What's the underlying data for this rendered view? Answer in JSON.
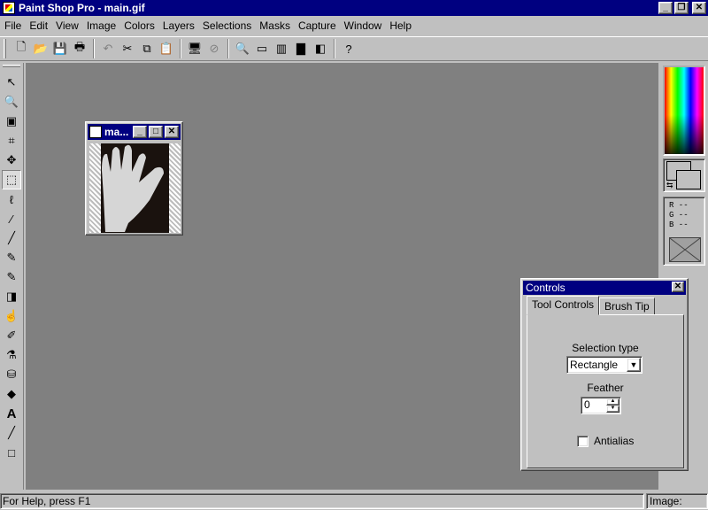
{
  "app": {
    "title": "Paint Shop Pro - main.gif"
  },
  "menu": [
    {
      "label": "File",
      "name": "menu-file"
    },
    {
      "label": "Edit",
      "name": "menu-edit"
    },
    {
      "label": "View",
      "name": "menu-view"
    },
    {
      "label": "Image",
      "name": "menu-image"
    },
    {
      "label": "Colors",
      "name": "menu-colors"
    },
    {
      "label": "Layers",
      "name": "menu-layers"
    },
    {
      "label": "Selections",
      "name": "menu-selections"
    },
    {
      "label": "Masks",
      "name": "menu-masks"
    },
    {
      "label": "Capture",
      "name": "menu-capture"
    },
    {
      "label": "Window",
      "name": "menu-window"
    },
    {
      "label": "Help",
      "name": "menu-help"
    }
  ],
  "toolbar": [
    {
      "icon": "new-file-icon",
      "glyph": "🗋"
    },
    {
      "icon": "open-folder-icon",
      "glyph": "📂"
    },
    {
      "icon": "save-icon",
      "glyph": "💾"
    },
    {
      "icon": "print-icon",
      "glyph": "🖶"
    },
    {
      "sep": true
    },
    {
      "icon": "undo-icon",
      "glyph": "↶",
      "disabled": true
    },
    {
      "icon": "cut-icon",
      "glyph": "✂"
    },
    {
      "icon": "copy-icon",
      "glyph": "⧉"
    },
    {
      "icon": "paste-icon",
      "glyph": "📋"
    },
    {
      "sep": true
    },
    {
      "icon": "full-screen-icon",
      "glyph": "🖥"
    },
    {
      "icon": "no-entry-icon",
      "glyph": "⊘",
      "disabled": true
    },
    {
      "sep": true
    },
    {
      "icon": "zoom-icon",
      "glyph": "🔍"
    },
    {
      "icon": "toolbar-toggle-icon",
      "glyph": "▭"
    },
    {
      "icon": "color-palette-icon",
      "glyph": "▥"
    },
    {
      "icon": "histogram-icon",
      "glyph": "▇"
    },
    {
      "icon": "layers-icon",
      "glyph": "◧"
    },
    {
      "sep": true
    },
    {
      "icon": "context-help-icon",
      "glyph": "?"
    }
  ],
  "tools": [
    {
      "icon": "arrow-tool-icon",
      "glyph": "↖"
    },
    {
      "icon": "zoom-tool-icon",
      "glyph": "🔍"
    },
    {
      "icon": "deform-tool-icon",
      "glyph": "▣"
    },
    {
      "icon": "crop-tool-icon",
      "glyph": "⌗"
    },
    {
      "icon": "mover-tool-icon",
      "glyph": "✥"
    },
    {
      "icon": "selection-tool-icon",
      "glyph": "⬚",
      "active": true
    },
    {
      "icon": "freehand-tool-icon",
      "glyph": "ℓ"
    },
    {
      "icon": "magic-wand-icon",
      "glyph": "⁄"
    },
    {
      "icon": "dropper-icon",
      "glyph": "╱"
    },
    {
      "icon": "paintbrush-icon",
      "glyph": "✎"
    },
    {
      "icon": "clone-brush-icon",
      "glyph": "✎"
    },
    {
      "icon": "color-replacer-icon",
      "glyph": "◨"
    },
    {
      "icon": "retouch-icon",
      "glyph": "☝"
    },
    {
      "icon": "eraser-icon",
      "glyph": "✐"
    },
    {
      "icon": "picture-tube-icon",
      "glyph": "⚗"
    },
    {
      "icon": "airbrush-icon",
      "glyph": "⛁"
    },
    {
      "icon": "flood-fill-icon",
      "glyph": "◆"
    },
    {
      "icon": "text-tool-icon",
      "glyph": "A"
    },
    {
      "icon": "line-tool-icon",
      "glyph": "╱"
    },
    {
      "icon": "shape-tool-icon",
      "glyph": "□"
    }
  ],
  "image_window": {
    "title": "ma..."
  },
  "color_panel": {
    "r": "R --",
    "g": "G --",
    "b": "B --"
  },
  "controls": {
    "title": "Controls",
    "tabs": [
      "Tool Controls",
      "Brush Tip"
    ],
    "selection_type_label": "Selection type",
    "selection_type_value": "Rectangle",
    "feather_label": "Feather",
    "feather_value": "0",
    "antialias_label": "Antialias",
    "antialias_checked": false
  },
  "status": {
    "help": "For Help, press F1",
    "image": "Image: None"
  }
}
